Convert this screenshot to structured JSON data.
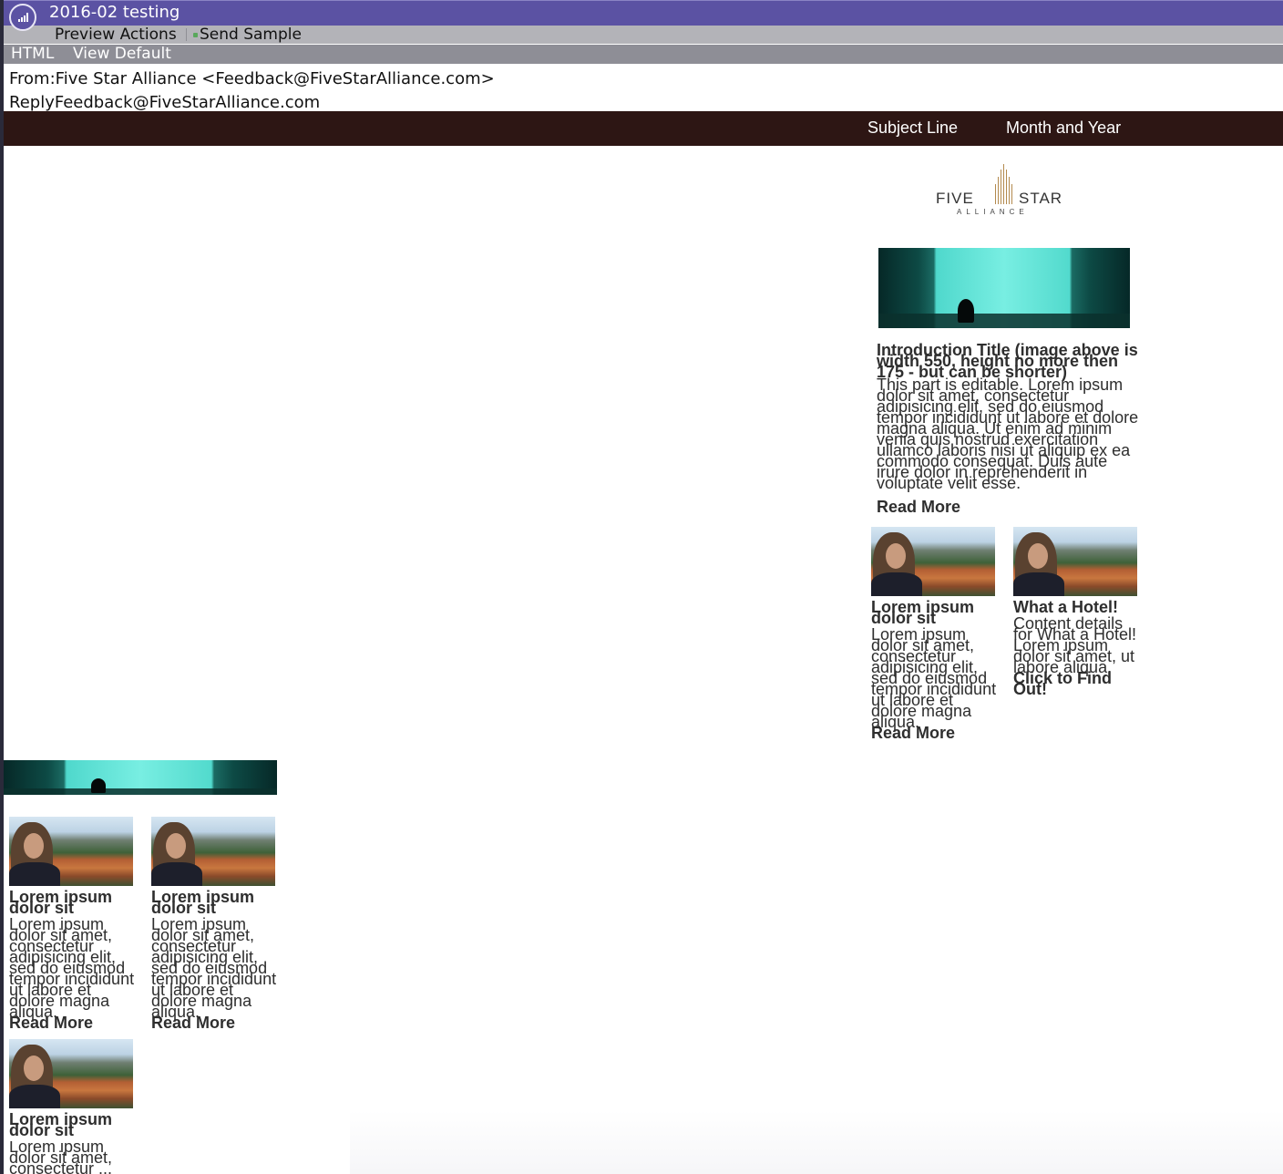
{
  "window": {
    "title": "2016-02 testing"
  },
  "toolbar": {
    "preview_actions": "Preview Actions",
    "send_sample": "Send Sample",
    "html": "HTML",
    "view_default": "View Default"
  },
  "email": {
    "from": "From:Five Star Alliance <Feedback@FiveStarAlliance.com>",
    "reply": "ReplyFeedback@FiveStarAlliance.com"
  },
  "banner": {
    "subject_line": "Subject Line",
    "month_year": "Month and Year"
  },
  "brand": {
    "word1": "FIVE",
    "word2": "STAR",
    "sub": "ALLIANCE"
  },
  "intro": {
    "title": "Introduction Title (image above is width 550, height no more then 175 - but can be shorter)",
    "body": "This part is editable. Lorem ipsum dolor sit amet, consectetur adipisicing elit, sed do eiusmod tempor incididunt ut labore et dolore magna aliqua. Ut enim ad minim venia quis nostrud exercitation ullamco laboris nisi ut aliquip ex ea commodo consequat. Duis aute irure dolor in reprehenderit in voluptate velit esse.",
    "read_more": "Read More"
  },
  "cards": [
    {
      "title": "Lorem ipsum dolor sit",
      "body": "Lorem ipsum dolor sit amet, consectetur adipisicing elit, sed do eiusmod tempor incididunt ut labore et dolore magna aliqua.",
      "link": "Read More"
    },
    {
      "title": "What a Hotel!",
      "body": "Content details for What a Hotel! Lorem ipsum dolor sit amet, ut labore aliqua.",
      "link": "Click to Find Out!"
    }
  ],
  "lower_cards": [
    {
      "title": "Lorem ipsum dolor sit",
      "body": "Lorem ipsum dolor sit amet, consectetur adipisicing elit, sed do eiusmod tempor incididunt ut labore et dolore magna aliqua.",
      "link": "Read More"
    },
    {
      "title": "Lorem ipsum dolor sit",
      "body": "Lorem ipsum dolor sit amet, consectetur adipisicing elit, sed do eiusmod tempor incididunt ut labore et dolore magna aliqua.",
      "link": "Read More"
    },
    {
      "title": "Lorem ipsum dolor sit",
      "body": "Lorem ipsum dolor sit amet, consectetur ..."
    }
  ],
  "colors": {
    "titlebar": "#5b52a3",
    "toolbar": "#b3b3b8",
    "toolbar2": "#8e8e96",
    "band": "#2d1614"
  }
}
